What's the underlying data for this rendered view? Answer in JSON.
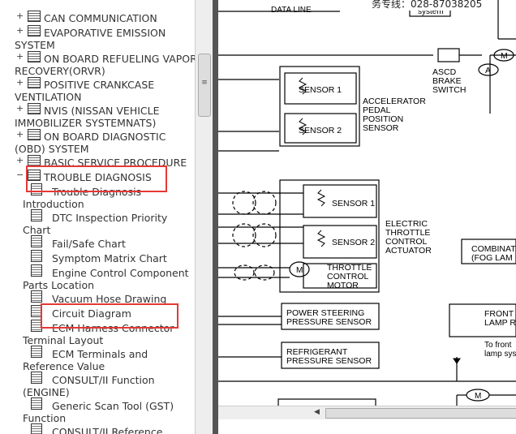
{
  "tree": {
    "items": [
      {
        "label": "CAN COMMUNICATION",
        "cont": ""
      },
      {
        "label": "EVAPORATIVE EMISSION",
        "cont": "SYSTEM"
      },
      {
        "label": "ON BOARD REFUELING VAPOR",
        "cont": "RECOVERY(ORVR)"
      },
      {
        "label": "POSITIVE CRANKCASE",
        "cont": "VENTILATION"
      },
      {
        "label": "NVIS (NISSAN VEHICLE",
        "cont": "IMMOBILIZER SYSTEMNATS)"
      },
      {
        "label": "ON BOARD DIAGNOSTIC",
        "cont": "(OBD) SYSTEM"
      },
      {
        "label": "BASIC SERVICE PROCEDURE",
        "cont": ""
      },
      {
        "label": "TROUBLE DIAGNOSIS",
        "cont": ""
      }
    ],
    "children": [
      {
        "label": "Trouble Diagnosis",
        "cont": "Introduction"
      },
      {
        "label": "DTC Inspection Priority",
        "cont": "Chart"
      },
      {
        "label": "Fail/Safe Chart",
        "cont": ""
      },
      {
        "label": "Symptom Matrix Chart",
        "cont": ""
      },
      {
        "label": "Engine Control Component",
        "cont": "Parts Location"
      },
      {
        "label": "Vacuum Hose Drawing",
        "cont": ""
      },
      {
        "label": "Circuit Diagram",
        "cont": ""
      },
      {
        "label": "ECM Harness Connector",
        "cont": "Terminal Layout"
      },
      {
        "label": "ECM Terminals and",
        "cont": "Reference Value"
      },
      {
        "label": "CONSULT/II Function",
        "cont": "(ENGINE)"
      },
      {
        "label": "Generic Scan Tool (GST)",
        "cont": "Function"
      },
      {
        "label": "CONSULT/II Reference",
        "cont": ""
      }
    ]
  },
  "banner": "务专线：028-87038205",
  "diagram": {
    "data_line": "DATA LINE",
    "system": "system",
    "ascd": [
      "ASCD",
      "BRAKE",
      "SWITCH"
    ],
    "accelerator": [
      "ACCELERATOR",
      "PEDAL",
      "POSITION",
      "SENSOR"
    ],
    "etca": [
      "ELECTRIC",
      "THROTTLE",
      "CONTROL",
      "ACTUATOR"
    ],
    "sensor1": "SENSOR 1",
    "sensor2": "SENSOR 2",
    "throttle_motor": [
      "THROTTLE",
      "CONTROL",
      "MOTOR"
    ],
    "power_steering": [
      "POWER STEERING",
      "PRESSURE SENSOR"
    ],
    "refrigerant": [
      "REFRIGERANT",
      "PRESSURE SENSOR"
    ],
    "combination": [
      "COMBINAT",
      "(FOG LAM"
    ],
    "front_lamp": [
      "FRONT",
      "LAMP RE"
    ],
    "to_front": [
      "To front",
      "lamp sys"
    ],
    "m": "M",
    "a": "A"
  }
}
